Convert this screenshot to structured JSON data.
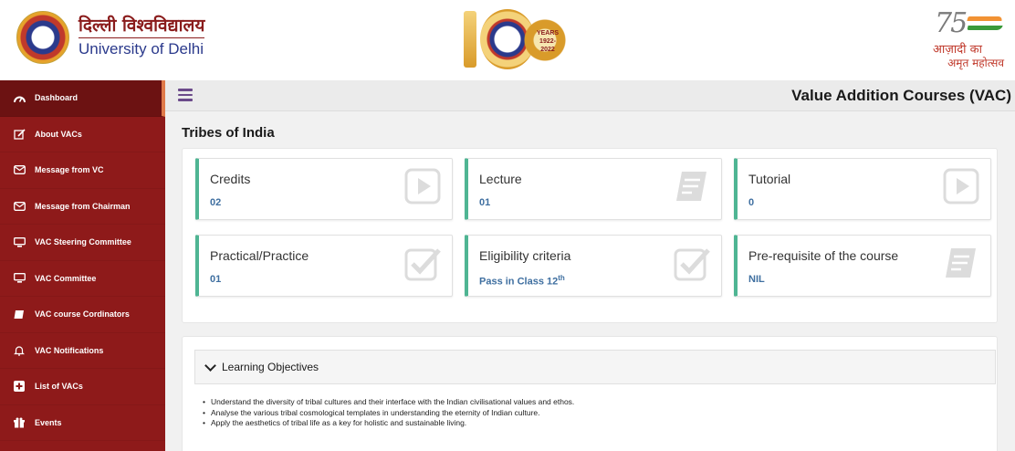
{
  "header": {
    "du_hindi": "दिल्ली विश्वविद्यालय",
    "du_english": "University of Delhi",
    "centenary_years": "YEARS",
    "centenary_range": "1922-2022",
    "azadi_line1": "आज़ादी का",
    "azadi_line2": "अमृत महोत्सव"
  },
  "sidebar": {
    "items": [
      {
        "label": "Dashboard",
        "icon": "dashboard-icon",
        "active": true
      },
      {
        "label": "About VACs",
        "icon": "edit-icon"
      },
      {
        "label": "Message from VC",
        "icon": "envelope-icon"
      },
      {
        "label": "Message from Chairman",
        "icon": "envelope-icon"
      },
      {
        "label": "VAC Steering Committee",
        "icon": "monitor-icon"
      },
      {
        "label": "VAC Committee",
        "icon": "monitor-icon"
      },
      {
        "label": "VAC course Cordinators",
        "icon": "book-icon"
      },
      {
        "label": "VAC Notifications",
        "icon": "bell-icon"
      },
      {
        "label": "List of VACs",
        "icon": "plus-square-icon"
      },
      {
        "label": "Events",
        "icon": "gift-icon"
      }
    ]
  },
  "topbar": {
    "title": "Value Addition Courses (VAC)"
  },
  "course": {
    "title": "Tribes of India",
    "boxes": [
      {
        "label": "Credits",
        "value": "02",
        "icon": "play-square-icon"
      },
      {
        "label": "Lecture",
        "value": "01",
        "icon": "document-icon"
      },
      {
        "label": "Tutorial",
        "value": "0",
        "icon": "play-square-icon"
      },
      {
        "label": "Practical/Practice",
        "value": "01",
        "icon": "check-square-icon"
      },
      {
        "label": "Eligibility criteria",
        "value": "Pass in Class 12",
        "value_sup": "th",
        "icon": "check-square-icon"
      },
      {
        "label": "Pre-requisite of the course",
        "value": "NIL",
        "icon": "document-icon"
      }
    ]
  },
  "learning_objectives": {
    "title": "Learning Objectives",
    "items": [
      "Understand the diversity of tribal cultures and their interface with the Indian civilisational values and ethos.",
      "Analyse the various tribal cosmological templates in understanding the eternity of Indian culture.",
      "Apply the aesthetics of tribal life as a key for holistic and sustainable living."
    ]
  },
  "colors": {
    "sidebar_bg": "#8e1a1a",
    "sidebar_active": "#6c1212",
    "box_accent": "#4fb593",
    "value_text": "#3f6fa0"
  }
}
